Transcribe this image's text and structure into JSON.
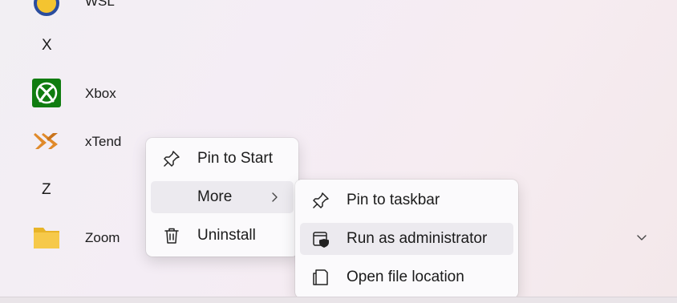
{
  "apps": [
    {
      "label": "WSL",
      "icon": "wsl-icon"
    },
    {
      "label": "Xbox",
      "icon": "xbox-icon"
    },
    {
      "label": "xTend",
      "icon": "xtend-icon"
    },
    {
      "label": "Zoom",
      "icon": "folder-icon"
    }
  ],
  "group_letters": {
    "x": "X",
    "z": "Z"
  },
  "context_menu": {
    "items": [
      {
        "label": "Pin to Start",
        "icon": "pin-icon"
      },
      {
        "label": "More",
        "icon": "none",
        "has_submenu": true,
        "highlighted": true
      },
      {
        "label": "Uninstall",
        "icon": "trash-icon"
      }
    ]
  },
  "submenu": {
    "items": [
      {
        "label": "Pin to taskbar",
        "icon": "pin-icon"
      },
      {
        "label": "Run as administrator",
        "icon": "shield-window-icon",
        "highlighted": true
      },
      {
        "label": "Open file location",
        "icon": "file-location-icon"
      }
    ]
  },
  "colors": {
    "xbox_green": "#107c10",
    "xtend_orange": "#e08a2a",
    "folder_yellow": "#f2c33a",
    "menu_bg": "#fbfafc",
    "highlight": "#eceaef"
  }
}
